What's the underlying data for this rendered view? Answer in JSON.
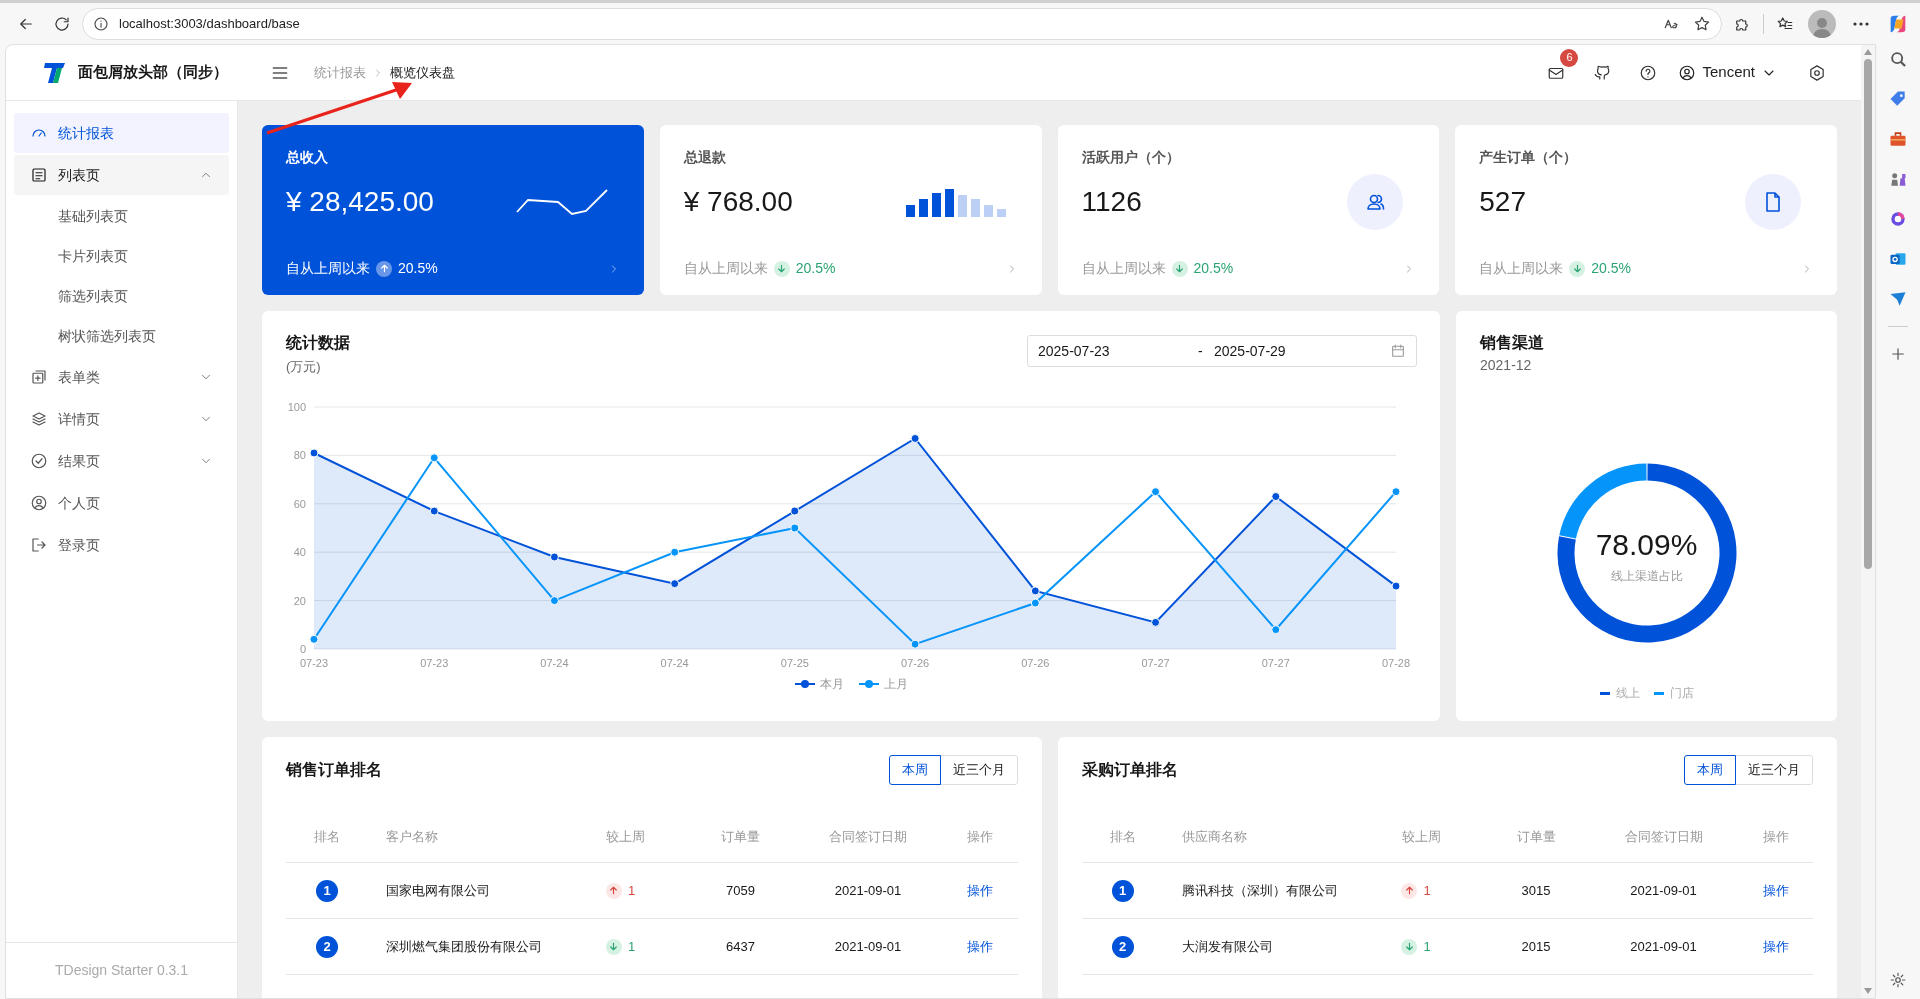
{
  "browser": {
    "url": "localhost:3003/dashboard/base"
  },
  "header": {
    "brand": "面包屑放头部（同步）",
    "breadcrumb": [
      "统计报表",
      "概览仪表盘"
    ],
    "notification_count": "6",
    "user": "Tencent"
  },
  "sidebar": {
    "items": [
      {
        "label": "统计报表",
        "selected": true
      },
      {
        "label": "列表页",
        "selected": false,
        "expanded": true,
        "children": [
          {
            "label": "基础列表页",
            "selected": false
          },
          {
            "label": "卡片列表页",
            "selected": false
          },
          {
            "label": "筛选列表页",
            "selected": false
          },
          {
            "label": "树状筛选列表页",
            "selected": false
          }
        ]
      },
      {
        "label": "表单类",
        "selected": false,
        "expanded": false
      },
      {
        "label": "详情页",
        "selected": false,
        "expanded": false
      },
      {
        "label": "结果页",
        "selected": false,
        "expanded": false
      },
      {
        "label": "个人页",
        "selected": false
      },
      {
        "label": "登录页",
        "selected": false
      }
    ],
    "footer": "TDesign Starter 0.3.1"
  },
  "stat_cards": [
    {
      "title": "总收入",
      "value": "¥ 28,425.00",
      "caption": "自从上周以来",
      "rising": true,
      "change": "20.5%",
      "highlighted": true
    },
    {
      "title": "总退款",
      "value": "¥ 768.00",
      "caption": "自从上周以来",
      "rising": false,
      "change": "20.5%",
      "highlighted": false
    },
    {
      "title": "活跃用户（个）",
      "value": "1126",
      "caption": "自从上周以来",
      "rising": false,
      "change": "20.5%",
      "highlighted": false
    },
    {
      "title": "产生订单（个）",
      "value": "527",
      "caption": "自从上周以来",
      "rising": false,
      "change": "20.5%",
      "highlighted": false
    }
  ],
  "statistics": {
    "title": "统计数据",
    "unit": "(万元)",
    "date_start": "2025-07-23",
    "separator": "-",
    "date_end": "2025-07-29",
    "chart_data": {
      "type": "line",
      "grid": true,
      "categories": [
        "07-23",
        "07-23",
        "07-24",
        "07-24",
        "07-25",
        "07-26",
        "07-26",
        "07-27",
        "07-27",
        "07-28"
      ],
      "ylim": [
        0,
        100
      ],
      "yticks": [
        0,
        20,
        40,
        60,
        80,
        100
      ],
      "series": [
        {
          "name": "本月",
          "color": "#0052d9",
          "type": "area",
          "marker": true,
          "values": [
            81,
            57,
            38,
            27,
            57,
            87,
            24,
            11,
            63,
            26
          ]
        },
        {
          "name": "上月",
          "color": "#0594fa",
          "type": "line",
          "marker": true,
          "values": [
            4,
            79,
            20,
            40,
            50,
            2,
            19,
            65,
            8,
            65
          ]
        }
      ]
    }
  },
  "channels": {
    "title": "销售渠道",
    "period": "2021-12",
    "percent": "78.09%",
    "caption": "线上渠道占比",
    "chart_data": {
      "type": "donut",
      "categories": [
        "线上",
        "门店"
      ],
      "values": [
        78.09,
        21.91
      ],
      "colors": [
        "#0052d9",
        "#0594fa"
      ]
    }
  },
  "rankings": [
    {
      "title": "销售订单排名",
      "tabs": [
        {
          "label": "本周",
          "selected": true
        },
        {
          "label": "近三个月",
          "selected": false
        }
      ],
      "columns": [
        "排名",
        "客户名称",
        "较上周",
        "订单量",
        "合同签订日期",
        "操作"
      ],
      "rows": [
        {
          "rank": "1",
          "name": "国家电网有限公司",
          "rising": true,
          "change": "1",
          "orders": "7059",
          "date": "2021-09-01",
          "action": "操作"
        },
        {
          "rank": "2",
          "name": "深圳燃气集团股份有限公司",
          "rising": false,
          "change": "1",
          "orders": "6437",
          "date": "2021-09-01",
          "action": "操作"
        }
      ]
    },
    {
      "title": "采购订单排名",
      "tabs": [
        {
          "label": "本周",
          "selected": true
        },
        {
          "label": "近三个月",
          "selected": false
        }
      ],
      "columns": [
        "排名",
        "供应商名称",
        "较上周",
        "订单量",
        "合同签订日期",
        "操作"
      ],
      "rows": [
        {
          "rank": "1",
          "name": "腾讯科技（深圳）有限公司",
          "rising": true,
          "change": "1",
          "orders": "3015",
          "date": "2021-09-01",
          "action": "操作"
        },
        {
          "rank": "2",
          "name": "大润发有限公司",
          "rising": false,
          "change": "1",
          "orders": "2015",
          "date": "2021-09-01",
          "action": "操作"
        }
      ]
    }
  ]
}
